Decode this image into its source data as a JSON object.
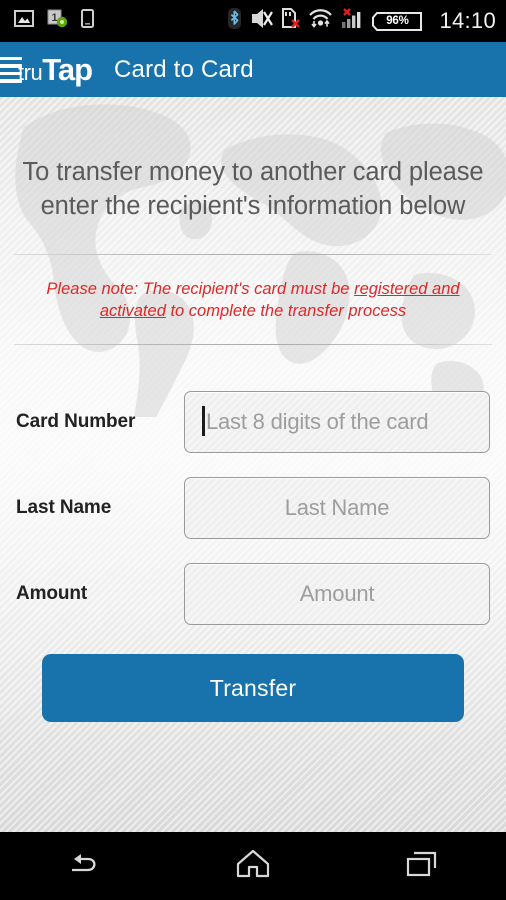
{
  "statusbar": {
    "time": "14:10",
    "battery_percent": "96%",
    "left_icons": [
      {
        "name": "photo-icon"
      },
      {
        "name": "app-update-badge-icon"
      },
      {
        "name": "sim-card-icon"
      }
    ],
    "right_icons": [
      {
        "name": "bluetooth-icon"
      },
      {
        "name": "vibrate-off-icon"
      },
      {
        "name": "sd-card-error-icon"
      },
      {
        "name": "wifi-data-icon"
      },
      {
        "name": "signal-no-service-icon"
      },
      {
        "name": "battery-icon"
      }
    ]
  },
  "appbar": {
    "menu_icon": "hamburger-menu-icon",
    "logo_part1": "tru",
    "logo_part2": "Tap",
    "title": "Card to Card",
    "color": "#1873ad"
  },
  "main": {
    "headline_line1": "To transfer money to another card please",
    "headline_line2": "enter the recipient's information below",
    "note_prefix": "Please note: The recipient's card must be ",
    "note_underline1": "registered and activated",
    "note_suffix": " to complete the transfer process",
    "note_color": "#e02727"
  },
  "form": {
    "fields": [
      {
        "label": "Card Number",
        "placeholder": "Last 8 digits of the card",
        "value": "",
        "focused": true,
        "align": "left"
      },
      {
        "label": "Last Name",
        "placeholder": "Last Name",
        "value": "",
        "focused": false,
        "align": "center"
      },
      {
        "label": "Amount",
        "placeholder": "Amount",
        "value": "",
        "focused": false,
        "align": "center"
      }
    ],
    "submit_label": "Transfer"
  },
  "navbar": {
    "back_icon": "back-arrow-icon",
    "home_icon": "home-icon",
    "recents_icon": "recent-apps-icon"
  }
}
